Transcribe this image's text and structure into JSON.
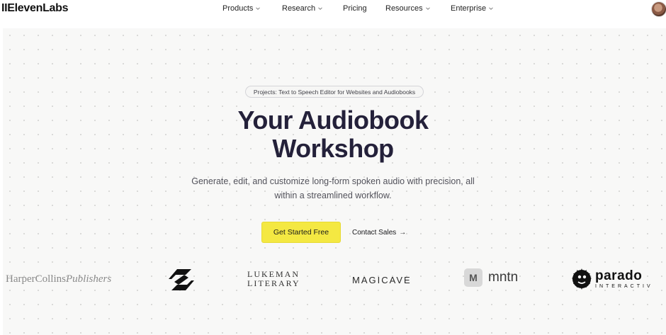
{
  "nav": {
    "logo": "IIElevenLabs",
    "items": [
      {
        "label": "Products",
        "dropdown": true
      },
      {
        "label": "Research",
        "dropdown": true
      },
      {
        "label": "Pricing",
        "dropdown": false
      },
      {
        "label": "Resources",
        "dropdown": true
      },
      {
        "label": "Enterprise",
        "dropdown": true
      }
    ]
  },
  "hero": {
    "pill": "Projects: Text to Speech Editor for Websites and Audiobooks",
    "title_line1": "Your Audiobook",
    "title_line2": "Workshop",
    "subtitle_line1": "Generate, edit, and customize long-form spoken audio with precision, all",
    "subtitle_line2": "within a streamlined workflow.",
    "cta_label": "Get Started Free",
    "contact_label": "Contact Sales",
    "contact_arrow": "→"
  },
  "logos": {
    "harpercollins_a": "HarperCollins",
    "harpercollins_b": "Publishers",
    "lukeman_1": "LUKEMAN",
    "lukeman_2": "LITERARY",
    "magicave": "MAGICAVE",
    "mntn_mark": "M",
    "mntn": "mntn",
    "paradox": "parado",
    "paradox_sub": "INTERACTIV"
  },
  "colors": {
    "cta_bg": "#f4e842",
    "title": "#24213a",
    "hero_bg": "#f8f8f7"
  }
}
